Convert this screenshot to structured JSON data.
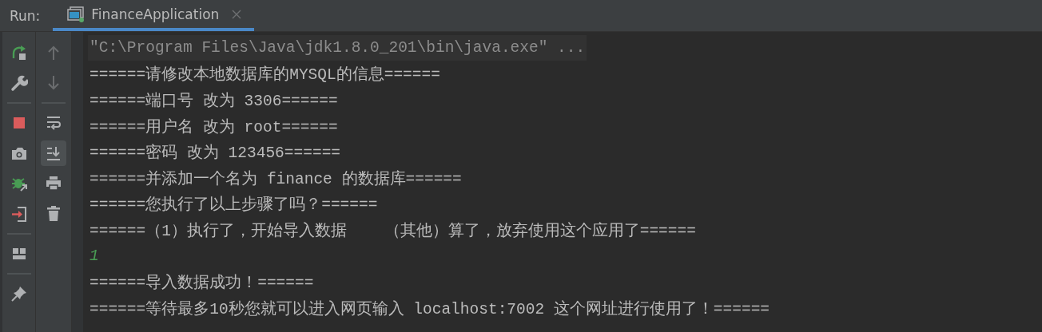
{
  "run_panel": {
    "label": "Run:",
    "tabs": [
      {
        "title": "FinanceApplication",
        "selected": true,
        "running": true
      }
    ]
  },
  "left_toolbar": [
    {
      "kind": "rerun"
    },
    {
      "kind": "wrench"
    },
    {
      "kind": "separator"
    },
    {
      "kind": "stop"
    },
    {
      "kind": "camera"
    },
    {
      "kind": "debug"
    },
    {
      "kind": "exit"
    },
    {
      "kind": "separator"
    },
    {
      "kind": "layout"
    },
    {
      "kind": "separator"
    },
    {
      "kind": "pin"
    }
  ],
  "right_toolbar": [
    {
      "kind": "up",
      "disabled": true,
      "selected": false
    },
    {
      "kind": "down",
      "disabled": true,
      "selected": false
    },
    {
      "kind": "separator"
    },
    {
      "kind": "wrap",
      "disabled": false,
      "selected": false
    },
    {
      "kind": "scroll-end",
      "disabled": false,
      "selected": true
    },
    {
      "kind": "print",
      "disabled": false,
      "selected": false
    },
    {
      "kind": "trash",
      "disabled": false,
      "selected": false
    }
  ],
  "console_lines": [
    {
      "kind": "command",
      "text": "\"C:\\Program Files\\Java\\jdk1.8.0_201\\bin\\java.exe\" ..."
    },
    {
      "kind": "output",
      "text": "======请修改本地数据库的MYSQL的信息======"
    },
    {
      "kind": "output",
      "text": "======端口号 改为 3306======"
    },
    {
      "kind": "output",
      "text": "======用户名 改为 root======"
    },
    {
      "kind": "output",
      "text": "======密码 改为 123456======"
    },
    {
      "kind": "output",
      "text": "======并添加一个名为 finance 的数据库======"
    },
    {
      "kind": "output",
      "text": "======您执行了以上步骤了吗？======"
    },
    {
      "kind": "output",
      "text": "======（1）执行了，开始导入数据    （其他）算了，放弃使用这个应用了======"
    },
    {
      "kind": "input",
      "text": "1"
    },
    {
      "kind": "output",
      "text": "======导入数据成功！======"
    },
    {
      "kind": "output",
      "text": "======等待最多10秒您就可以进入网页输入 localhost:7002 这个网址进行使用了！======"
    }
  ]
}
